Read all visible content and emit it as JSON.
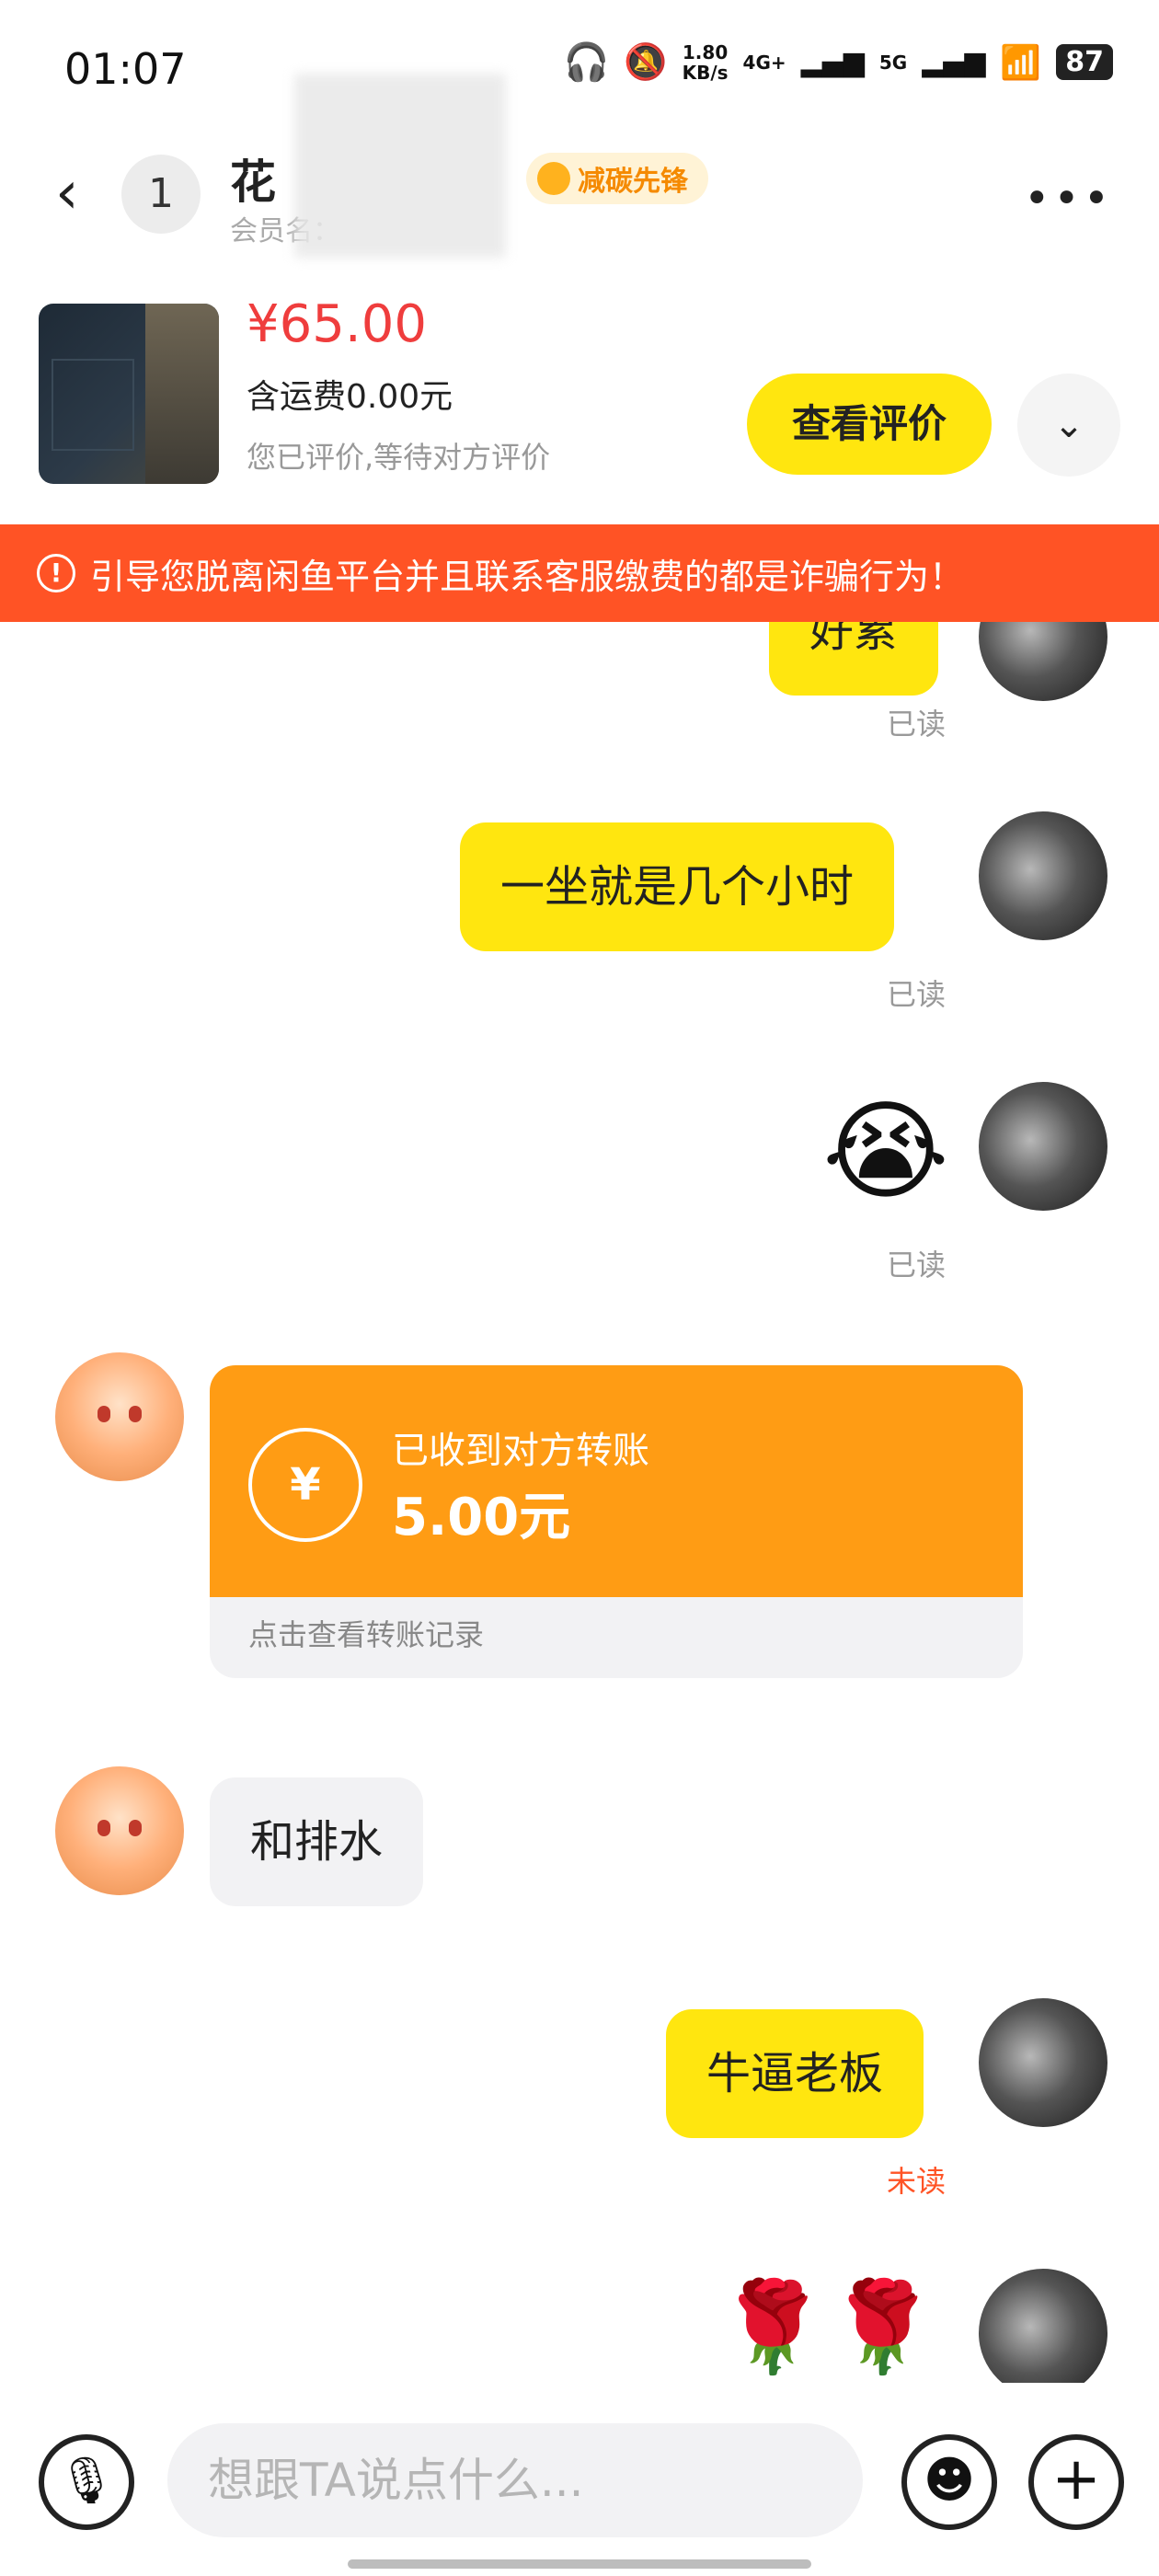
{
  "status_bar": {
    "time": "01:07",
    "net_speed": "1.80",
    "net_unit": "KB/s",
    "signal_1": "4G+",
    "signal_2": "5G",
    "battery": "87"
  },
  "header": {
    "unread_count": "1",
    "title": "花",
    "member_label": "会员名：",
    "tag": "减碳先锋"
  },
  "product": {
    "price": "¥65.00",
    "shipping": "含运费0.00元",
    "review_status": "您已评价,等待对方评价",
    "review_button": "查看评价"
  },
  "warning": {
    "text": "引导您脱离闲鱼平台并且联系客服缴费的都是诈骗行为！"
  },
  "messages": [
    {
      "from": "me",
      "text": "好累",
      "status": "已读"
    },
    {
      "from": "me",
      "text": "一坐就是几个小时",
      "status": "已读"
    },
    {
      "from": "me",
      "text": "😭",
      "status": "已读"
    },
    {
      "from": "other",
      "type": "transfer",
      "title": "已收到对方转账",
      "amount": "5.00元",
      "footer": "点击查看转账记录"
    },
    {
      "from": "other",
      "text": "和排水"
    },
    {
      "from": "me",
      "text": "牛逼老板",
      "status": "未读"
    },
    {
      "from": "me",
      "text": "🌹🌹"
    }
  ],
  "input": {
    "placeholder": "想跟TA说点什么..."
  }
}
